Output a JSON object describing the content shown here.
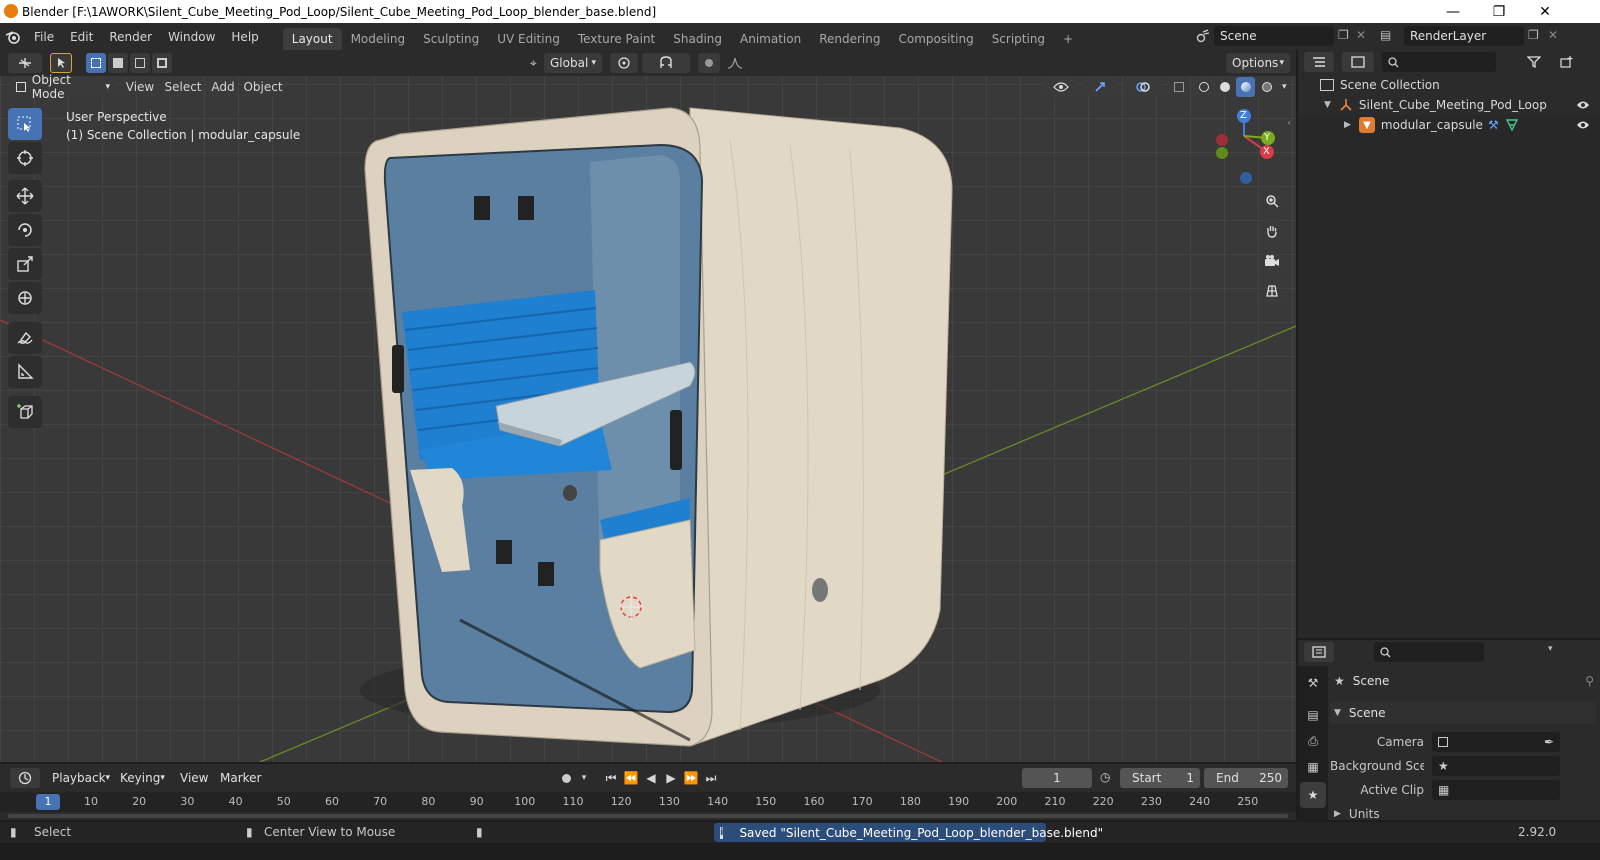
{
  "window": {
    "title": "Blender [F:\\1AWORK\\Silent_Cube_Meeting_Pod_Loop/Silent_Cube_Meeting_Pod_Loop_blender_base.blend]",
    "controls": [
      "minimize-icon",
      "restore-icon",
      "close-icon"
    ]
  },
  "menu": {
    "items": [
      "File",
      "Edit",
      "Render",
      "Window",
      "Help"
    ]
  },
  "workspaces": {
    "tabs": [
      "Layout",
      "Modeling",
      "Sculpting",
      "UV Editing",
      "Texture Paint",
      "Shading",
      "Animation",
      "Rendering",
      "Compositing",
      "Scripting"
    ],
    "active": "Layout",
    "add": "+"
  },
  "scene_selector": {
    "value": "Scene"
  },
  "layer_selector": {
    "value": "RenderLayer"
  },
  "viewport_header": {
    "transform_orientation": "Global",
    "options": "Options"
  },
  "viewport_menu": {
    "mode": "Object Mode",
    "items": [
      "View",
      "Select",
      "Add",
      "Object"
    ]
  },
  "viewport_info": {
    "line1": "User Perspective",
    "line2": "(1) Scene Collection | modular_capsule"
  },
  "gizmo": {
    "x": "X",
    "y": "Y",
    "z": "Z"
  },
  "outliner": {
    "root": "Scene Collection",
    "collection": "Silent_Cube_Meeting_Pod_Loop",
    "object": "modular_capsule"
  },
  "properties": {
    "context": "Scene",
    "panel": "Scene",
    "camera_label": "Camera",
    "background_label": "Background Sce...",
    "clip_label": "Active Clip",
    "units_label": "Units"
  },
  "timeline": {
    "menus": [
      "Playback",
      "Keying",
      "View",
      "Marker"
    ],
    "current_frame": "1",
    "start_label": "Start",
    "start_value": "1",
    "end_label": "End",
    "end_value": "250",
    "ruler": [
      "1",
      "10",
      "20",
      "30",
      "40",
      "50",
      "60",
      "70",
      "80",
      "90",
      "100",
      "110",
      "120",
      "130",
      "140",
      "150",
      "160",
      "170",
      "180",
      "190",
      "200",
      "210",
      "220",
      "230",
      "240",
      "250"
    ]
  },
  "statusbar": {
    "select": "Select",
    "center": "Center View to Mouse",
    "message": "Saved \"Silent_Cube_Meeting_Pod_Loop_blender_base.blend\"",
    "version": "2.92.0"
  },
  "colors": {
    "accent": "#4772b3",
    "header": "#2b2b2b",
    "viewport": "#393939",
    "pod_wood": "#e2d8c6",
    "pod_inner": "#5b7fa0",
    "seat_blue": "#1f7fd0"
  }
}
